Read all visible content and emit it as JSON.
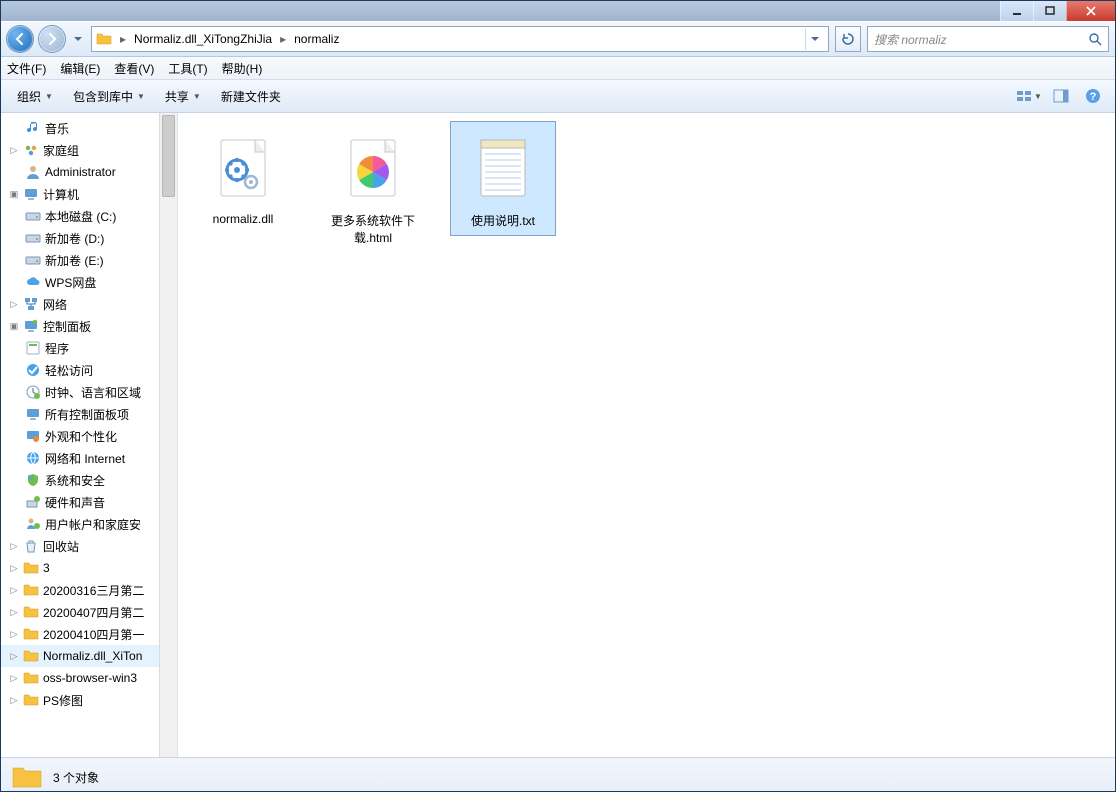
{
  "window_controls": {
    "min": "–",
    "max": "❐",
    "close": "✕"
  },
  "breadcrumb": [
    "Normaliz.dll_XiTongZhiJia",
    "normaliz"
  ],
  "search_placeholder": "搜索 normaliz",
  "menu": [
    "文件(F)",
    "编辑(E)",
    "查看(V)",
    "工具(T)",
    "帮助(H)"
  ],
  "toolbar": {
    "organize": "组织",
    "include": "包含到库中",
    "share": "共享",
    "new_folder": "新建文件夹"
  },
  "sidebar": [
    {
      "label": "音乐",
      "level": 1,
      "icon": "music"
    },
    {
      "label": "家庭组",
      "level": 0,
      "icon": "homegroup",
      "exp": ""
    },
    {
      "label": "Administrator",
      "level": 1,
      "icon": "user"
    },
    {
      "label": "计算机",
      "level": 0,
      "icon": "computer",
      "exp": "▣"
    },
    {
      "label": "本地磁盘 (C:)",
      "level": 1,
      "icon": "drive"
    },
    {
      "label": "新加卷 (D:)",
      "level": 1,
      "icon": "drive"
    },
    {
      "label": "新加卷 (E:)",
      "level": 1,
      "icon": "drive"
    },
    {
      "label": "WPS网盘",
      "level": 1,
      "icon": "cloud"
    },
    {
      "label": "网络",
      "level": 0,
      "icon": "network",
      "exp": ""
    },
    {
      "label": "控制面板",
      "level": 0,
      "icon": "cpanel",
      "exp": "▣"
    },
    {
      "label": "程序",
      "level": 1,
      "icon": "programs"
    },
    {
      "label": "轻松访问",
      "level": 1,
      "icon": "ease"
    },
    {
      "label": "时钟、语言和区域",
      "level": 1,
      "icon": "clock"
    },
    {
      "label": "所有控制面板项",
      "level": 1,
      "icon": "allcp"
    },
    {
      "label": "外观和个性化",
      "level": 1,
      "icon": "appearance"
    },
    {
      "label": "网络和 Internet",
      "level": 1,
      "icon": "netinet"
    },
    {
      "label": "系统和安全",
      "level": 1,
      "icon": "security"
    },
    {
      "label": "硬件和声音",
      "level": 1,
      "icon": "hardware"
    },
    {
      "label": "用户帐户和家庭安",
      "level": 1,
      "icon": "useracc"
    },
    {
      "label": "回收站",
      "level": 0,
      "icon": "recycle",
      "exp": ""
    },
    {
      "label": "3",
      "level": 0,
      "icon": "folder",
      "exp": ""
    },
    {
      "label": "20200316三月第二",
      "level": 0,
      "icon": "folder",
      "exp": ""
    },
    {
      "label": "20200407四月第二",
      "level": 0,
      "icon": "folder",
      "exp": ""
    },
    {
      "label": "20200410四月第一",
      "level": 0,
      "icon": "folder",
      "exp": ""
    },
    {
      "label": "Normaliz.dll_XiTon",
      "level": 0,
      "icon": "folder",
      "exp": "",
      "sel": true
    },
    {
      "label": "oss-browser-win3",
      "level": 0,
      "icon": "folder",
      "exp": ""
    },
    {
      "label": "PS修图",
      "level": 0,
      "icon": "folder",
      "exp": ""
    }
  ],
  "files": [
    {
      "name": "normaliz.dll",
      "icon": "dll"
    },
    {
      "name": "更多系统软件下载.html",
      "icon": "html"
    },
    {
      "name": "使用说明.txt",
      "icon": "txt",
      "sel": true
    }
  ],
  "status": "3 个对象"
}
